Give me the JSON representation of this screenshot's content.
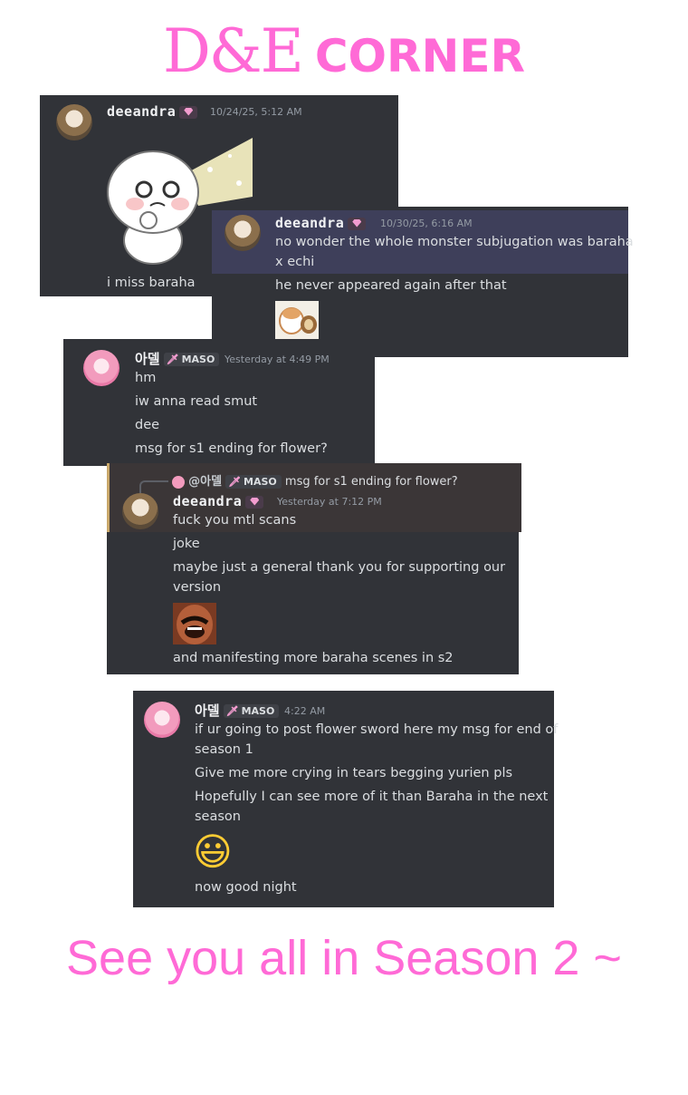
{
  "title": {
    "brand": "D&E",
    "word": "CORNER"
  },
  "messages": {
    "m1": {
      "name": "deeandra",
      "time": "10/24/25, 5:12 AM",
      "text": "i miss baraha"
    },
    "m2": {
      "name": "deeandra",
      "time": "10/30/25, 6:16 AM",
      "line1": "no wonder the whole monster subjugation was baraha",
      "line2": "x echi",
      "line3": "he never appeared again after that"
    },
    "m3": {
      "name": "아델",
      "tag": "MASO",
      "time": "Yesterday at 4:49 PM",
      "l1": "hm",
      "l2": "iw anna read smut",
      "l3": "dee",
      "l4": "msg for s1 ending for flower?"
    },
    "m4": {
      "reply": {
        "name": "@아델",
        "tag": "MASO",
        "text": "msg for s1 ending for flower?"
      },
      "name": "deeandra",
      "time": "Yesterday at 7:12 PM",
      "l1": "fuck you mtl scans",
      "l2": "joke",
      "l3": "maybe just a general thank you for supporting our",
      "l4": "version",
      "l5": "and manifesting more baraha scenes in s2"
    },
    "m5": {
      "name": "아델",
      "tag": "MASO",
      "time": "4:22 AM",
      "l1": "if ur going to post flower sword here my msg for end of",
      "l2": "season 1",
      "l3": "Give me more crying in tears begging yurien pls",
      "l4": "Hopefully I can see more of it than Baraha in the next",
      "l5": "season",
      "emoji": "😃",
      "l6": "now good night"
    }
  },
  "footer": "See you all in Season 2 ~",
  "colors": {
    "accent": "#ff6ad6",
    "panel": "#313338",
    "highlight": "#3e3f5a"
  }
}
